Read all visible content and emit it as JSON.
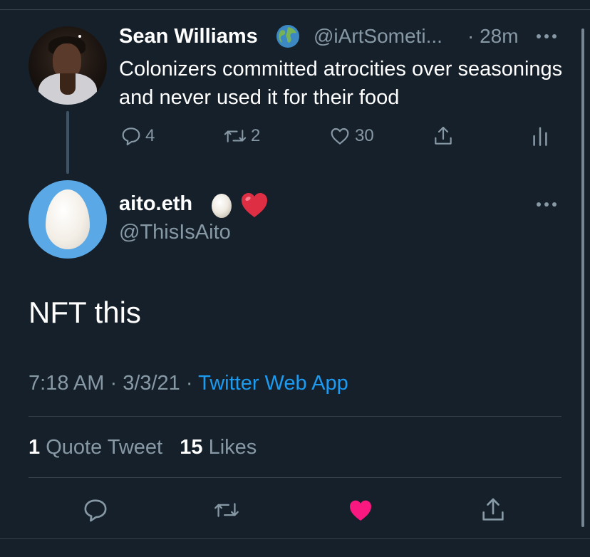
{
  "parent_tweet": {
    "name": "Sean Williams",
    "handle": "@iArtSometi...",
    "time": "· 28m",
    "text": "Colonizers committed atrocities over seasonings and never used it for their food",
    "replies": "4",
    "retweets": "2",
    "likes": "30"
  },
  "main_tweet": {
    "name": "aito.eth",
    "handle": "@ThisIsAito",
    "text": "NFT this",
    "time": "7:18 AM",
    "date": "3/3/21",
    "source": "Twitter Web App",
    "quote_count": "1",
    "quote_label": "Quote Tweet",
    "like_count": "15",
    "like_label": "Likes"
  },
  "colors": {
    "background": "#15202b",
    "muted": "#8899a6",
    "link": "#1d9bf0",
    "like_active": "#f91880"
  },
  "icons": [
    "globe-emoji",
    "egg-emoji",
    "red-heart-emoji",
    "reply-icon",
    "retweet-icon",
    "like-icon",
    "share-icon",
    "analytics-icon",
    "more-icon"
  ]
}
